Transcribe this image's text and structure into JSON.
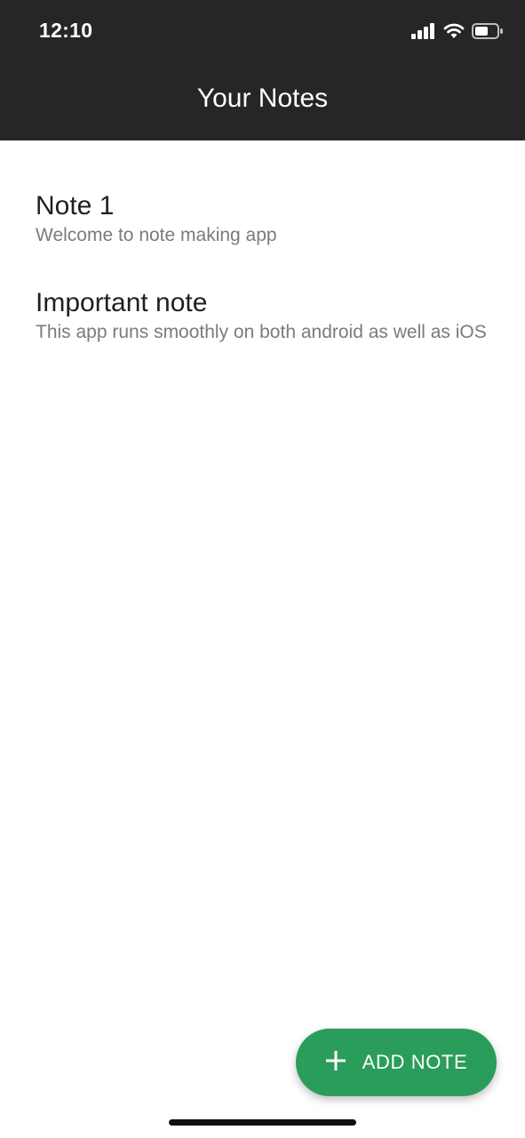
{
  "status_bar": {
    "time": "12:10",
    "icons": [
      "signal-icon",
      "wifi-icon",
      "battery-icon"
    ]
  },
  "header": {
    "title": "Your Notes",
    "background": "#262626"
  },
  "notes": [
    {
      "title": "Note 1",
      "preview": "Welcome to note making app"
    },
    {
      "title": "Important note",
      "preview": "This app runs smoothly on both android as well as iOS"
    }
  ],
  "fab": {
    "label": "ADD NOTE",
    "icon": "plus-icon",
    "color": "#2a9d5a"
  }
}
